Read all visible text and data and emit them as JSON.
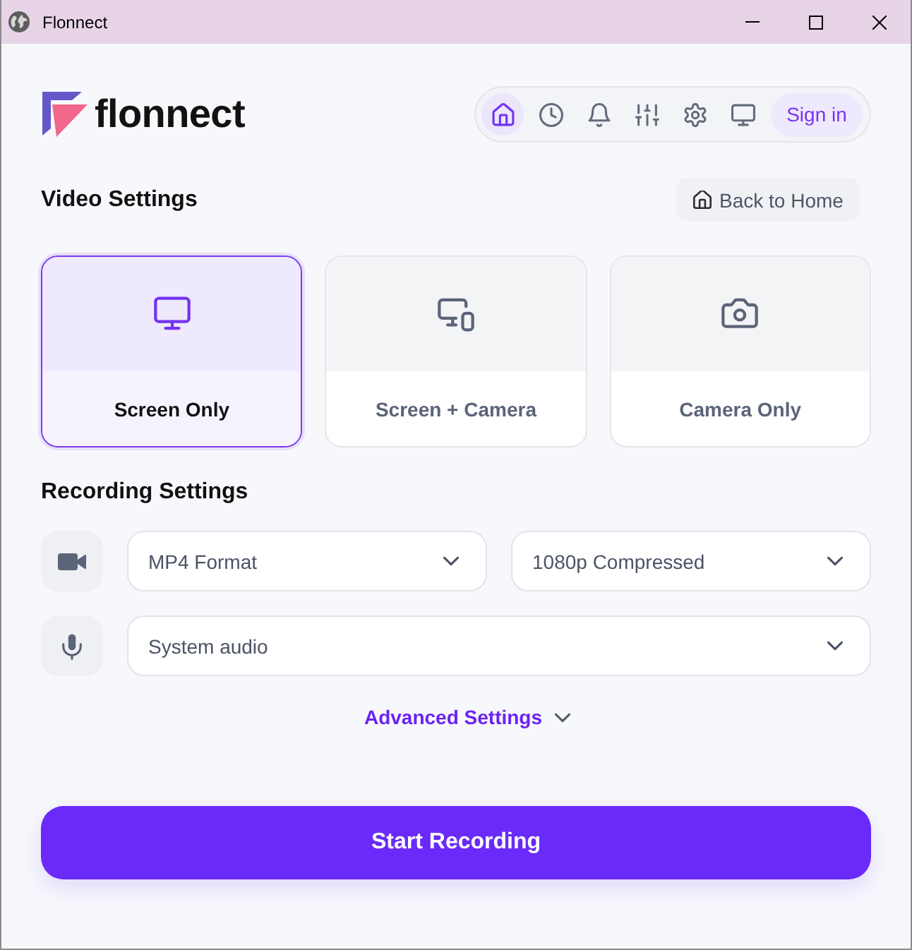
{
  "window": {
    "title": "Flonnect"
  },
  "header": {
    "logo": "flonnect",
    "nav": [
      {
        "kind": "home",
        "selected": true
      },
      {
        "kind": "history",
        "selected": false
      },
      {
        "kind": "notifications",
        "selected": false
      },
      {
        "kind": "filters",
        "selected": false
      },
      {
        "kind": "settings",
        "selected": false
      },
      {
        "kind": "display",
        "selected": false
      }
    ],
    "sign_in": "Sign in"
  },
  "video_settings": {
    "title": "Video Settings",
    "back_button": "Back to Home",
    "modes": [
      {
        "kind": "screen",
        "label": "Screen Only",
        "selected": true
      },
      {
        "kind": "combined",
        "label": "Screen + Camera",
        "selected": false
      },
      {
        "kind": "camera",
        "label": "Camera Only",
        "selected": false
      }
    ]
  },
  "recording_settings": {
    "title": "Recording Settings",
    "rows": [
      {
        "kind": "video",
        "selects": [
          "MP4 Format",
          "1080p Compressed"
        ]
      },
      {
        "kind": "audio",
        "selects": [
          "System audio"
        ]
      }
    ]
  },
  "advanced_settings": {
    "label": "Advanced Settings",
    "expanded": false
  },
  "start_button": "Start Recording"
}
